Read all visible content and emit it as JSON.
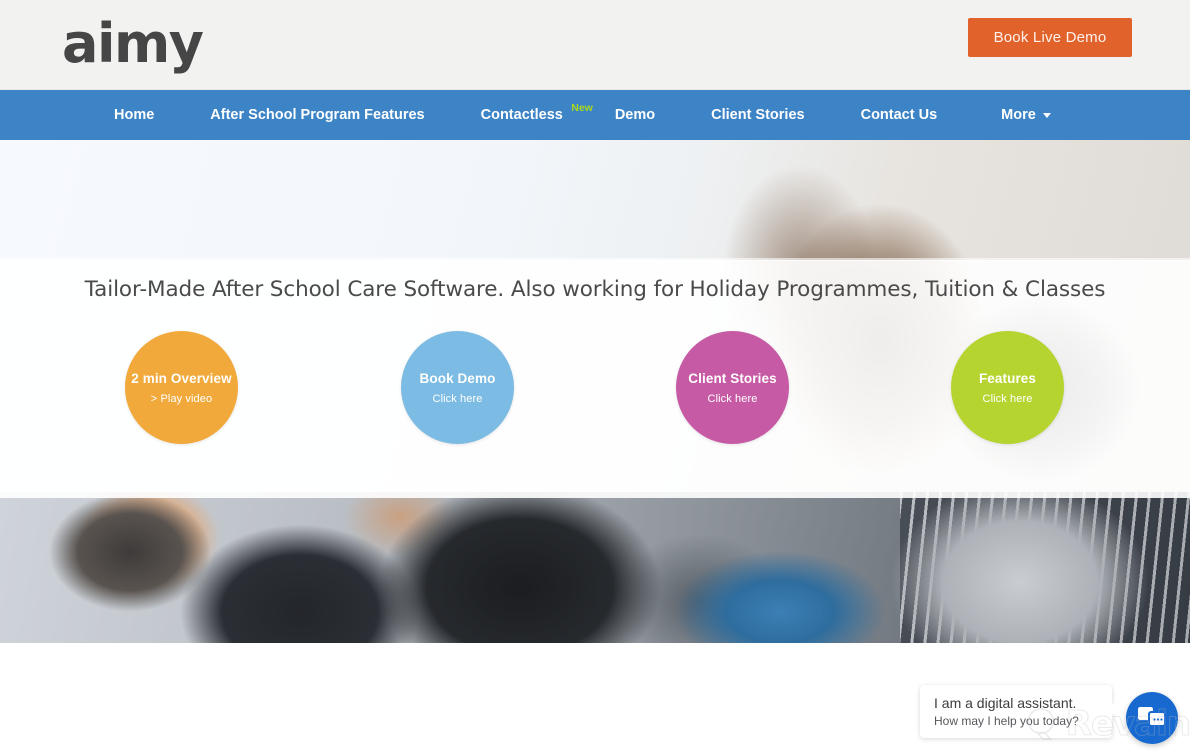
{
  "header": {
    "logo_text": "aimy",
    "cta_label": "Book Live Demo",
    "background_color": "#f2f2f1",
    "cta_color": "#e2622c"
  },
  "nav": {
    "background_color": "#3d84c6",
    "items": [
      {
        "label": "Home",
        "badge": ""
      },
      {
        "label": "After School Program Features",
        "badge": ""
      },
      {
        "label": "Contactless",
        "badge": "New"
      },
      {
        "label": "Demo",
        "badge": ""
      },
      {
        "label": "Client Stories",
        "badge": ""
      },
      {
        "label": "Contact Us",
        "badge": ""
      },
      {
        "label": "More",
        "badge": ""
      }
    ],
    "badge_color": "#a9d91c"
  },
  "hero": {
    "headline": "Tailor-Made After School Care Software. Also working for Holiday Programmes, Tuition & Classes",
    "circles": [
      {
        "title": "2 min Overview",
        "subtitle": "> Play video",
        "color": "#f2a93b"
      },
      {
        "title": "Book Demo",
        "subtitle": "Click here",
        "color": "#7cbbe3"
      },
      {
        "title": "Client Stories",
        "subtitle": "Click here",
        "color": "#c75aa4"
      },
      {
        "title": "Features",
        "subtitle": "Click here",
        "color": "#b5d430"
      }
    ]
  },
  "chat": {
    "line1": "I am a digital assistant.",
    "line2": "How may I help you today?",
    "fab_color": "#1769cf"
  },
  "watermark": {
    "text": "Revain"
  }
}
